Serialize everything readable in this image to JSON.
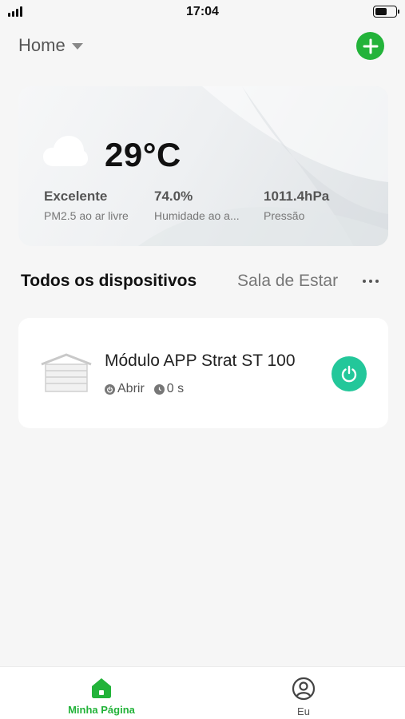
{
  "status_bar": {
    "time": "17:04",
    "battery_level": 0.6
  },
  "header": {
    "home_label": "Home"
  },
  "weather": {
    "temperature": "29°C",
    "air_quality_value": "Excelente",
    "air_quality_label": "PM2.5 ao ar livre",
    "humidity_value": "74.0%",
    "humidity_label": "Humidade ao a...",
    "pressure_value": "1011.4hPa",
    "pressure_label": "Pressão"
  },
  "devices_section": {
    "title": "Todos os dispositivos",
    "room_tab": "Sala de Estar"
  },
  "device": {
    "name": "Módulo APP Strat ST 100",
    "action_label": "Abrir",
    "timer_label": "0 s"
  },
  "tab_bar": {
    "home_label": "Minha Página",
    "me_label": "Eu"
  },
  "colors": {
    "accent_green": "#23b33a",
    "power_teal": "#23c79a"
  }
}
